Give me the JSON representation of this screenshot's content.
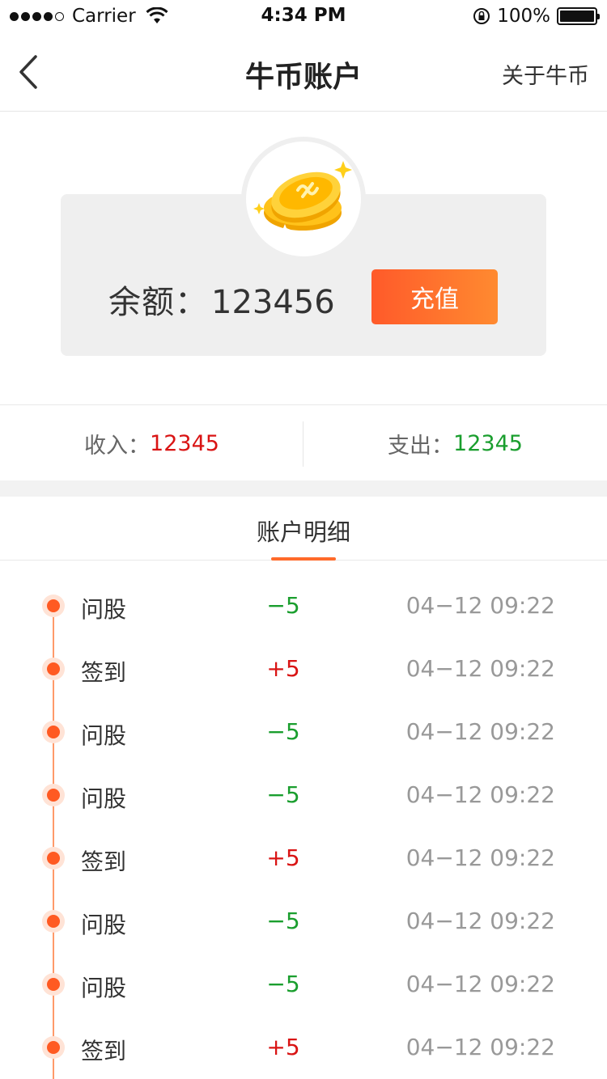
{
  "status_bar": {
    "carrier": "Carrier",
    "time": "4:34 PM",
    "battery": "100%"
  },
  "nav": {
    "title": "牛币账户",
    "right_link": "关于牛币"
  },
  "balance": {
    "label": "余额：",
    "value": "123456",
    "recharge_label": "充值"
  },
  "summary": {
    "income_label": "收入：",
    "income_value": "12345",
    "expense_label": "支出：",
    "expense_value": "12345"
  },
  "details": {
    "title": "账户明细",
    "rows": [
      {
        "name": "问股",
        "amount": "−5",
        "time": "04−12 09:22",
        "sign": "neg"
      },
      {
        "name": "签到",
        "amount": "+5",
        "time": "04−12 09:22",
        "sign": "pos"
      },
      {
        "name": "问股",
        "amount": "−5",
        "time": "04−12 09:22",
        "sign": "neg"
      },
      {
        "name": "问股",
        "amount": "−5",
        "time": "04−12 09:22",
        "sign": "neg"
      },
      {
        "name": "签到",
        "amount": "+5",
        "time": "04−12 09:22",
        "sign": "pos"
      },
      {
        "name": "问股",
        "amount": "−5",
        "time": "04−12 09:22",
        "sign": "neg"
      },
      {
        "name": "问股",
        "amount": "−5",
        "time": "04−12 09:22",
        "sign": "neg"
      },
      {
        "name": "签到",
        "amount": "+5",
        "time": "04−12 09:22",
        "sign": "pos"
      }
    ]
  },
  "colors": {
    "accent": "#ff6a2a",
    "positive": "#d91414",
    "negative": "#1a9e2e"
  }
}
